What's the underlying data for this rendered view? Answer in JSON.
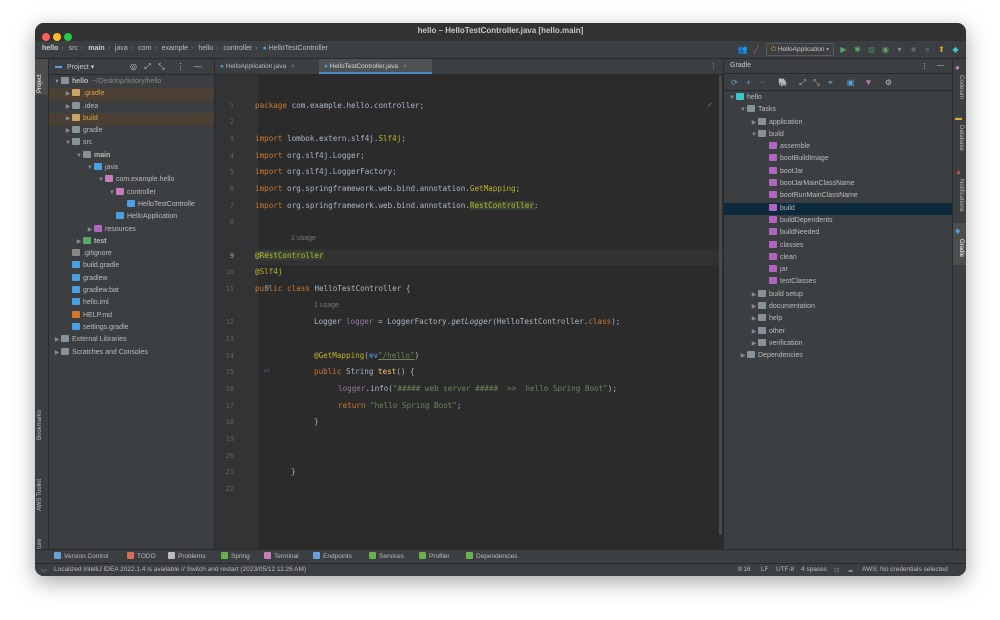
{
  "window": {
    "title": "hello – HelloTestController.java [hello.main]"
  },
  "breadcrumb": [
    "hello",
    "src",
    "main",
    "java",
    "com",
    "example",
    "hello",
    "controller",
    "HelloTestController"
  ],
  "toolbar": {
    "run_config": "HelloApplication"
  },
  "project": {
    "title": "Project",
    "tree": [
      {
        "label": "hello",
        "note": "~/Desktop/tistory/hello",
        "level": 0,
        "arrow": "down",
        "icon": "folder",
        "bold": true
      },
      {
        "label": ".gradle",
        "level": 1,
        "arrow": "right",
        "icon": "folder-orange",
        "selected": true
      },
      {
        "label": ".idea",
        "level": 1,
        "arrow": "right",
        "icon": "folder"
      },
      {
        "label": "build",
        "level": 1,
        "arrow": "right",
        "icon": "folder-orange",
        "selected": true
      },
      {
        "label": "gradle",
        "level": 1,
        "arrow": "right",
        "icon": "folder"
      },
      {
        "label": "src",
        "level": 1,
        "arrow": "down",
        "icon": "folder"
      },
      {
        "label": "main",
        "level": 2,
        "arrow": "down",
        "icon": "folder",
        "bold": true
      },
      {
        "label": "java",
        "level": 3,
        "arrow": "down",
        "icon": "folder-blue"
      },
      {
        "label": "com.example.hello",
        "level": 4,
        "arrow": "down",
        "icon": "package"
      },
      {
        "label": "controller",
        "level": 5,
        "arrow": "down",
        "icon": "package"
      },
      {
        "label": "HelloTestControlle",
        "level": 6,
        "icon": "class"
      },
      {
        "label": "HelloApplication",
        "level": 5,
        "icon": "class-spring"
      },
      {
        "label": "resources",
        "level": 3,
        "arrow": "right",
        "icon": "folder-res"
      },
      {
        "label": "test",
        "level": 2,
        "arrow": "right",
        "icon": "folder-green",
        "bold": true
      },
      {
        "label": ".gitignore",
        "level": 1,
        "icon": "gitignore"
      },
      {
        "label": "build.gradle",
        "level": 1,
        "icon": "gradle"
      },
      {
        "label": "gradlew",
        "level": 1,
        "icon": "file"
      },
      {
        "label": "gradlew.bat",
        "level": 1,
        "icon": "file"
      },
      {
        "label": "hello.iml",
        "level": 1,
        "icon": "iml"
      },
      {
        "label": "HELP.md",
        "level": 1,
        "icon": "md"
      },
      {
        "label": "settings.gradle",
        "level": 1,
        "icon": "gradle"
      },
      {
        "label": "External Libraries",
        "level": 0,
        "arrow": "right",
        "icon": "lib"
      },
      {
        "label": "Scratches and Consoles",
        "level": 0,
        "arrow": "right",
        "icon": "scratch"
      }
    ]
  },
  "left_strip": {
    "top": "Project",
    "bottom": [
      "Bookmarks",
      "AWS Toolkit",
      "Structure"
    ]
  },
  "right_strip": [
    "Codeium",
    "Database",
    "Notifications",
    "Gradle"
  ],
  "tabs": [
    {
      "label": "HelloApplication.java",
      "active": false
    },
    {
      "label": "HelloTestController.java",
      "active": true
    }
  ],
  "editor": {
    "lines": [
      {
        "n": "1"
      },
      {
        "n": "2"
      },
      {
        "n": "3"
      },
      {
        "n": "4"
      },
      {
        "n": "5"
      },
      {
        "n": "6"
      },
      {
        "n": "7"
      },
      {
        "n": "8"
      },
      {
        "n": "9"
      },
      {
        "n": "10"
      },
      {
        "n": "11"
      },
      {
        "n": "12"
      },
      {
        "n": "13"
      },
      {
        "n": "14"
      },
      {
        "n": "15"
      },
      {
        "n": "16"
      },
      {
        "n": "17"
      },
      {
        "n": "18"
      },
      {
        "n": "19"
      },
      {
        "n": "20"
      },
      {
        "n": "21"
      },
      {
        "n": "22"
      }
    ],
    "code": {
      "l1_kw": "package",
      "l1_rest": " com.example.hello.controller;",
      "l3_kw": "import",
      "l3_a": " lombok.extern.slf4j.",
      "l3_b": "Slf4j",
      "l3_c": ";",
      "l4_kw": "import",
      "l4_rest": " org.slf4j.Logger;",
      "l5_kw": "import",
      "l5_rest": " org.slf4j.LoggerFactory;",
      "l6_kw": "import",
      "l6_a": " org.springframework.web.bind.annotation.",
      "l6_b": "GetMapping",
      "l6_c": ";",
      "l7_kw": "import",
      "l7_a": " org.springframework.web.bind.annotation.",
      "l7_b": "RestController",
      "l7_c": ";",
      "usage1": "1 usage",
      "l9": "@RestController",
      "l10": "@Slf4j",
      "l11_kw": "public class",
      "l11_rest": " HelloTestController {",
      "usage2": "1 usage",
      "l12_a": "Logger ",
      "l12_f": "logger",
      "l12_b": " = LoggerFactory.",
      "l12_m": "getLogger",
      "l12_c": "(HelloTestController.",
      "l12_kw": "class",
      "l12_d": ");",
      "l14_an": "@GetMapping",
      "l14_a": "(",
      "l14_icon": "⊕∨",
      "l14_s": "\"/hello\"",
      "l14_b": ")",
      "l15_kw": "public",
      "l15_a": " String ",
      "l15_m": "test",
      "l15_b": "() {",
      "l16_f": "logger",
      "l16_a": ".info(",
      "l16_s": "\"##### web server #####  >>  hello Spring Boot\"",
      "l16_b": ");",
      "l17_kw": "return",
      "l17_s": " \"hello Spring Boot\"",
      "l17_b": ";",
      "l18": "}",
      "l21": "}"
    }
  },
  "gradle": {
    "title": "Gradle",
    "tree": [
      {
        "label": "hello",
        "level": 0,
        "arrow": "down",
        "icon": "elephant"
      },
      {
        "label": "Tasks",
        "level": 1,
        "arrow": "down",
        "icon": "folder"
      },
      {
        "label": "application",
        "level": 2,
        "arrow": "right",
        "icon": "folder"
      },
      {
        "label": "build",
        "level": 2,
        "arrow": "down",
        "icon": "folder"
      },
      {
        "label": "assemble",
        "level": 3,
        "icon": "task"
      },
      {
        "label": "bootBuildImage",
        "level": 3,
        "icon": "task"
      },
      {
        "label": "bootJar",
        "level": 3,
        "icon": "task"
      },
      {
        "label": "bootJarMainClassName",
        "level": 3,
        "icon": "task"
      },
      {
        "label": "bootRunMainClassName",
        "level": 3,
        "icon": "task"
      },
      {
        "label": "build",
        "level": 3,
        "icon": "task",
        "selected": true
      },
      {
        "label": "buildDependents",
        "level": 3,
        "icon": "task"
      },
      {
        "label": "buildNeeded",
        "level": 3,
        "icon": "task"
      },
      {
        "label": "classes",
        "level": 3,
        "icon": "task"
      },
      {
        "label": "clean",
        "level": 3,
        "icon": "task"
      },
      {
        "label": "jar",
        "level": 3,
        "icon": "task"
      },
      {
        "label": "testClasses",
        "level": 3,
        "icon": "task"
      },
      {
        "label": "build setup",
        "level": 2,
        "arrow": "right",
        "icon": "folder"
      },
      {
        "label": "documentation",
        "level": 2,
        "arrow": "right",
        "icon": "folder"
      },
      {
        "label": "help",
        "level": 2,
        "arrow": "right",
        "icon": "folder"
      },
      {
        "label": "other",
        "level": 2,
        "arrow": "right",
        "icon": "folder"
      },
      {
        "label": "verification",
        "level": 2,
        "arrow": "right",
        "icon": "folder"
      },
      {
        "label": "Dependencies",
        "level": 1,
        "arrow": "right",
        "icon": "folder"
      }
    ]
  },
  "bottom_tools": [
    {
      "label": "Version Control",
      "icon": "vcs-icon",
      "color": "#6aa0d8"
    },
    {
      "label": "TODO",
      "icon": "todo-icon",
      "color": "#d86a5a"
    },
    {
      "label": "Problems",
      "icon": "problems-icon",
      "color": "#bbbbbb"
    },
    {
      "label": "Spring",
      "icon": "spring-icon",
      "color": "#6ab04c"
    },
    {
      "label": "Terminal",
      "icon": "terminal-icon",
      "color": "#c77dbb"
    },
    {
      "label": "Endpoints",
      "icon": "endpoints-icon",
      "color": "#6aa0d8"
    },
    {
      "label": "Services",
      "icon": "services-icon",
      "color": "#6ab04c"
    },
    {
      "label": "Profiler",
      "icon": "profiler-icon",
      "color": "#6ab04c"
    },
    {
      "label": "Dependencies",
      "icon": "dependencies-icon",
      "color": "#6ab04c"
    }
  ],
  "status": {
    "message": "Localized IntelliJ IDEA 2022.1.4 is available // Switch and restart (2023/05/12 11:26 AM)",
    "position": "9:16",
    "line_sep": "LF",
    "encoding": "UTF-8",
    "indent": "4 spaces",
    "aws": "AWS: No credentials selected"
  },
  "colors": {
    "accent": "#4a88c7",
    "keyword": "#cc7832",
    "annotation": "#bbb529",
    "string": "#6a8759"
  }
}
